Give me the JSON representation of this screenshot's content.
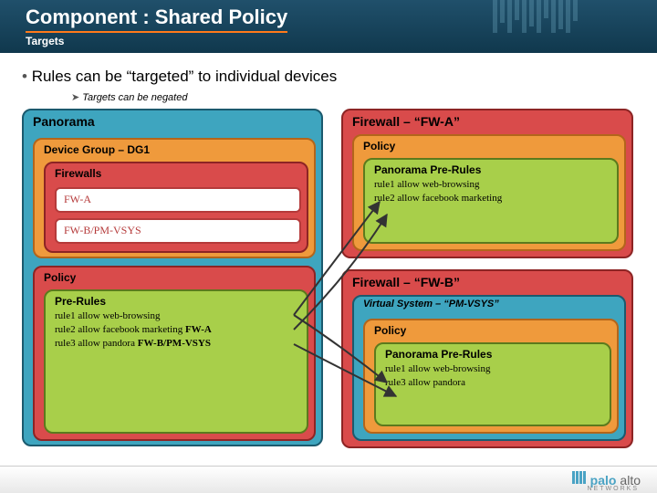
{
  "header": {
    "title": "Component : Shared Policy",
    "subtitle": "Targets"
  },
  "bullets": {
    "main": "Rules can be “targeted” to individual devices",
    "sub": "Targets can be negated"
  },
  "panorama": {
    "title": "Panorama",
    "dg": {
      "title": "Device Group – DG1"
    },
    "firewalls": {
      "title": "Firewalls",
      "items": [
        "FW-A",
        "FW-B/PM-VSYS"
      ]
    },
    "policy": {
      "title": "Policy",
      "pre": {
        "title": "Pre-Rules",
        "rules": [
          {
            "text": "rule1 allow web-browsing",
            "target": ""
          },
          {
            "text": "rule2 allow facebook marketing",
            "target": "FW-A"
          },
          {
            "text": "rule3 allow pandora",
            "target": "FW-B/PM-VSYS"
          }
        ]
      }
    }
  },
  "fw_a": {
    "title": "Firewall – “FW-A”",
    "policy": "Policy",
    "pre": {
      "title": "Panorama Pre-Rules",
      "rules": [
        "rule1 allow web-browsing",
        "rule2 allow facebook marketing"
      ]
    }
  },
  "fw_b": {
    "title": "Firewall – “FW-B”",
    "vsys": "Virtual System – “PM-VSYS”",
    "policy": "Policy",
    "pre": {
      "title": "Panorama Pre-Rules",
      "rules": [
        "rule1 allow web-browsing",
        "rule3 allow pandora"
      ]
    }
  },
  "footer": {
    "brand1": "palo",
    "brand2": "alto",
    "sub": "NETWORKS"
  }
}
